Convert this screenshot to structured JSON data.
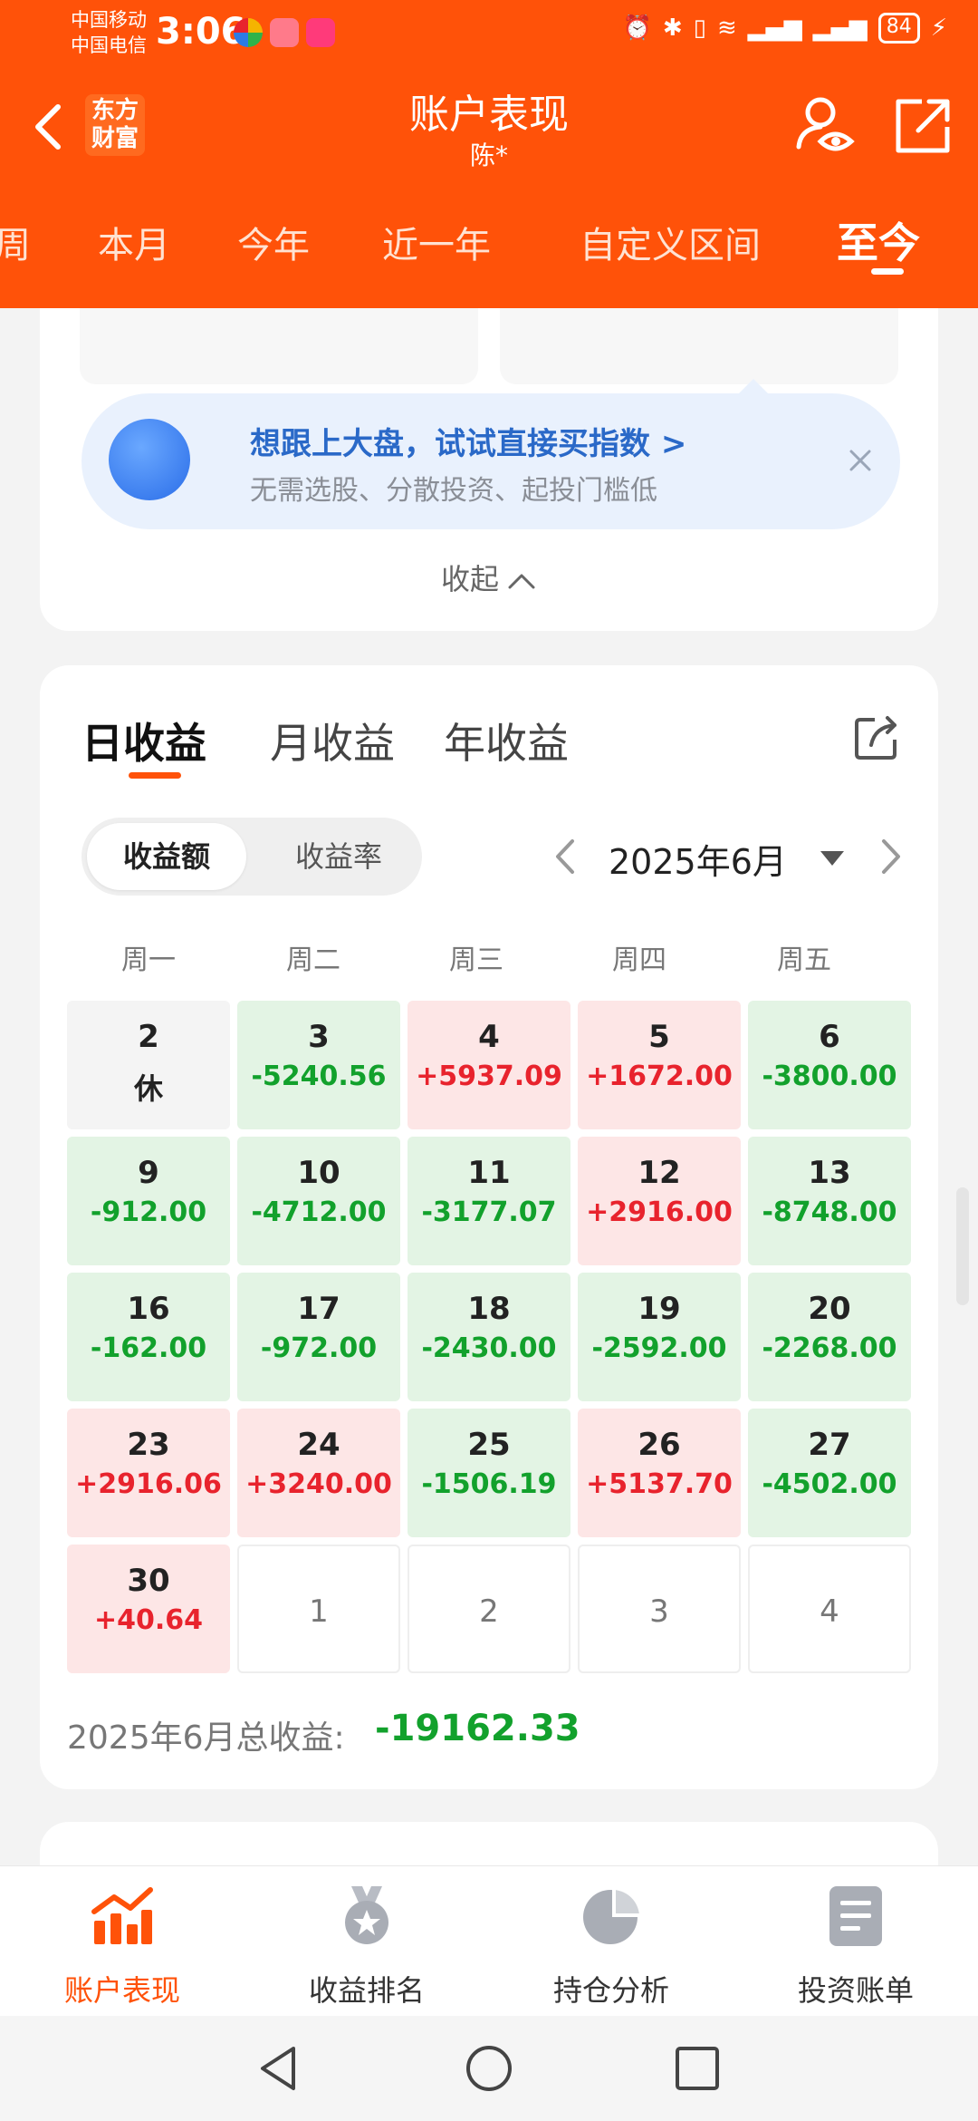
{
  "status_bar": {
    "carrier1": "中国移动",
    "carrier2": "中国电信",
    "time": "3:06",
    "battery": "84"
  },
  "header": {
    "logo_line1": "东方",
    "logo_line2": "财富",
    "title": "账户表现",
    "subtitle": "陈*",
    "periods": [
      "周",
      "本月",
      "今年",
      "近一年",
      "自定义区间",
      "至今"
    ],
    "active_period": "至今"
  },
  "promo": {
    "title": "想跟上大盘，试试直接买指数 >",
    "subtitle": "无需选股、分散投资、起投门槛低",
    "collapse_label": "收起"
  },
  "returns": {
    "tabs": [
      "日收益",
      "月收益",
      "年收益"
    ],
    "active_tab": "日收益",
    "segments": [
      "收益额",
      "收益率"
    ],
    "active_segment": "收益额",
    "month_label": "2025年6月",
    "weekdays": [
      "周一",
      "周二",
      "周三",
      "周四",
      "周五"
    ],
    "days": [
      {
        "day": "2",
        "value": "休",
        "state": "rest"
      },
      {
        "day": "3",
        "value": "-5240.56",
        "state": "green"
      },
      {
        "day": "4",
        "value": "+5937.09",
        "state": "red"
      },
      {
        "day": "5",
        "value": "+1672.00",
        "state": "red"
      },
      {
        "day": "6",
        "value": "-3800.00",
        "state": "green"
      },
      {
        "day": "9",
        "value": "-912.00",
        "state": "green"
      },
      {
        "day": "10",
        "value": "-4712.00",
        "state": "green"
      },
      {
        "day": "11",
        "value": "-3177.07",
        "state": "green"
      },
      {
        "day": "12",
        "value": "+2916.00",
        "state": "red"
      },
      {
        "day": "13",
        "value": "-8748.00",
        "state": "green"
      },
      {
        "day": "16",
        "value": "-162.00",
        "state": "green"
      },
      {
        "day": "17",
        "value": "-972.00",
        "state": "green"
      },
      {
        "day": "18",
        "value": "-2430.00",
        "state": "green"
      },
      {
        "day": "19",
        "value": "-2592.00",
        "state": "green"
      },
      {
        "day": "20",
        "value": "-2268.00",
        "state": "green"
      },
      {
        "day": "23",
        "value": "+2916.06",
        "state": "red"
      },
      {
        "day": "24",
        "value": "+3240.00",
        "state": "red"
      },
      {
        "day": "25",
        "value": "-1506.19",
        "state": "green"
      },
      {
        "day": "26",
        "value": "+5137.70",
        "state": "red"
      },
      {
        "day": "27",
        "value": "-4502.00",
        "state": "green"
      },
      {
        "day": "30",
        "value": "+40.64",
        "state": "red"
      },
      {
        "day": "1",
        "value": "",
        "state": "empty"
      },
      {
        "day": "2",
        "value": "",
        "state": "empty"
      },
      {
        "day": "3",
        "value": "",
        "state": "empty"
      },
      {
        "day": "4",
        "value": "",
        "state": "empty"
      }
    ],
    "total_label": "2025年6月总收益:",
    "total_value": "-19162.33"
  },
  "bottom_nav": [
    {
      "label": "账户表现",
      "icon": "trend-chart-icon",
      "active": true
    },
    {
      "label": "收益排名",
      "icon": "medal-icon",
      "active": false
    },
    {
      "label": "持仓分析",
      "icon": "pie-chart-icon",
      "active": false
    },
    {
      "label": "投资账单",
      "icon": "bill-icon",
      "active": false
    }
  ],
  "colors": {
    "brand": "#ff5209",
    "gain": "#e8232d",
    "loss": "#12a12c"
  }
}
